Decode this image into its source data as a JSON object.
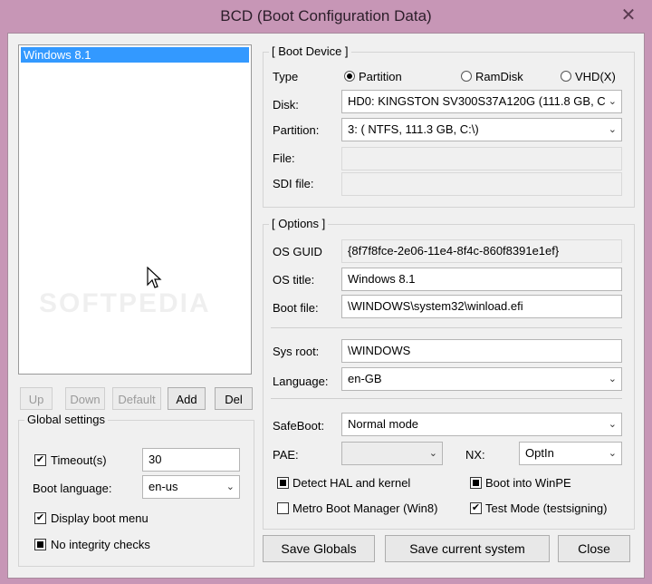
{
  "window": {
    "title": "BCD (Boot Configuration Data)",
    "close_glyph": "✕"
  },
  "entries": [
    "Windows 8.1"
  ],
  "watermark": "SOFTPEDIA",
  "list_buttons": {
    "up": "Up",
    "down": "Down",
    "default": "Default",
    "add": "Add",
    "del": "Del"
  },
  "global_settings": {
    "title": "Global settings",
    "timeout_label": "Timeout(s)",
    "timeout_value": "30",
    "boot_language_label": "Boot language:",
    "boot_language_value": "en-us",
    "display_boot_menu": "Display boot menu",
    "no_integrity_checks": "No integrity checks"
  },
  "boot_device": {
    "title": "[ Boot Device ]",
    "type_label": "Type",
    "type_options": [
      "Partition",
      "RamDisk",
      "VHD(X)"
    ],
    "disk_label": "Disk:",
    "disk_value": "HD0: KINGSTON SV300S37A120G (111.8 GB, C",
    "partition_label": "Partition:",
    "partition_value": "3: ( NTFS, 111.3 GB, C:\\)",
    "file_label": "File:",
    "sdi_label": "SDI file:"
  },
  "options": {
    "title": "[ Options ]",
    "os_guid_label": "OS GUID",
    "os_guid_value": "{8f7f8fce-2e06-11e4-8f4c-860f8391e1ef}",
    "os_title_label": "OS title:",
    "os_title_value": "Windows 8.1",
    "boot_file_label": "Boot file:",
    "boot_file_value": "\\WINDOWS\\system32\\winload.efi",
    "sys_root_label": "Sys root:",
    "sys_root_value": "\\WINDOWS",
    "language_label": "Language:",
    "language_value": "en-GB",
    "safeboot_label": "SafeBoot:",
    "safeboot_value": "Normal mode",
    "pae_label": "PAE:",
    "pae_value": "",
    "nx_label": "NX:",
    "nx_value": "OptIn",
    "detect_hal": "Detect HAL and kernel",
    "boot_into_winpe": "Boot into WinPE",
    "metro_boot": "Metro Boot Manager (Win8)",
    "test_mode": "Test Mode (testsigning)"
  },
  "bottom_buttons": {
    "save_globals": "Save Globals",
    "save_current": "Save current system",
    "close": "Close"
  },
  "icons": {
    "chevron": "chevron-down-icon",
    "checkmark": "✔"
  }
}
